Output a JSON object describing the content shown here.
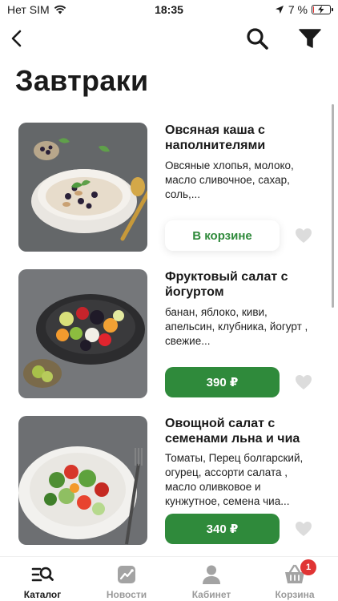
{
  "status_bar": {
    "carrier": "Нет SIM",
    "time": "18:35",
    "battery_percent": "7 %",
    "battery_level": 0.07
  },
  "nav": {
    "back_icon": "chevron-left-icon",
    "search_icon": "search-icon",
    "filter_icon": "filter-icon"
  },
  "page": {
    "title": "Завтраки"
  },
  "products": [
    {
      "name": "Овсяная каша с наполнителями",
      "description": "Овсяные хлопья, молоко, масло сливочное, сахар, соль,...",
      "button_label": "В корзине",
      "in_cart": true
    },
    {
      "name": "Фруктовый салат с йогуртом",
      "description": "банан, яблоко, киви, апельсин, клубника, йогурт , свежие...",
      "button_label": "390 ₽",
      "in_cart": false
    },
    {
      "name": "Овощной салат с семенами льна и чиа",
      "description": "Томаты, Перец болгарский, огурец, ассорти салата , масло оливковое и кунжутное, семена чиа...",
      "button_label": "340 ₽",
      "in_cart": false
    }
  ],
  "tab_bar": {
    "items": [
      {
        "label": "Каталог",
        "icon": "catalog-icon",
        "active": true
      },
      {
        "label": "Новости",
        "icon": "news-icon",
        "active": false
      },
      {
        "label": "Кабинет",
        "icon": "profile-icon",
        "active": false
      },
      {
        "label": "Корзина",
        "icon": "basket-icon",
        "active": false,
        "badge": "1"
      }
    ]
  },
  "colors": {
    "accent_green": "#2f8a3b",
    "badge_red": "#e03434",
    "inactive_tab": "#9a9a9a"
  }
}
